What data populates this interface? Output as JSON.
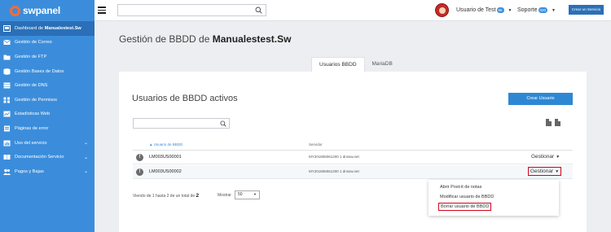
{
  "app": {
    "logo_text": "swpanel"
  },
  "sidebar": {
    "items": [
      {
        "label_prefix": "Dashboard de ",
        "label_bold": "Manualestest.Sw",
        "icon": "dashboard-icon"
      },
      {
        "label": "Gestión de Correo",
        "icon": "envelope-icon"
      },
      {
        "label": "Gestión de FTP",
        "icon": "ftp-folder-icon"
      },
      {
        "label": "Gestión Bases de Datos",
        "icon": "database-icon"
      },
      {
        "label": "Gestión de DNS",
        "icon": "dns-stack-icon"
      },
      {
        "label": "Gestión de Permisos",
        "icon": "permissions-grid-icon"
      },
      {
        "label": "Estadísticas Web",
        "icon": "stats-icon"
      },
      {
        "label": "Páginas de error",
        "icon": "error-page-icon"
      },
      {
        "label": "Uso del servicio",
        "icon": "usage-icon",
        "chevron": "⌄"
      },
      {
        "label": "Documentación Servicio",
        "icon": "docs-icon",
        "chevron": "⌄"
      },
      {
        "label": "Pagos y Bajas",
        "icon": "payments-icon",
        "chevron": "⌄"
      }
    ]
  },
  "topbar": {
    "search_placeholder": "",
    "user_label": "Usuario de Test",
    "user_badge": "86",
    "soporte_label": "Soporte",
    "soporte_badge": "020",
    "create_service": "Crear un Servicio"
  },
  "page": {
    "title_prefix": "Gestión de BBDD de ",
    "title_bold": "Manualestest.Sw",
    "tabs": [
      {
        "label": "Usuarios BBDD",
        "active": true
      },
      {
        "label": "MariaDB",
        "active": false
      }
    ]
  },
  "panel": {
    "title": "Usuarios de BBDD activos",
    "create_button": "Crear Usuario",
    "filter_placeholder": "",
    "columns": [
      "▲ Usuario de BBDD",
      "Servidor"
    ],
    "rows": [
      {
        "user": "LM003US00001",
        "server": "MY201806061200 1 dnssw.net",
        "action": "Gestionar"
      },
      {
        "user": "LM003US00002",
        "server": "MY201806061200 1 dnssw.net",
        "action": "Gestionar"
      }
    ],
    "pager": {
      "prefix": "Viendo de",
      "from": "1",
      "mid": "hasta",
      "to": "2",
      "mid2": "de un total de",
      "total": "2"
    },
    "show_label": "Mostrar",
    "page_size": "50"
  },
  "dropdown": {
    "items": [
      "Abrir Post-it de notas",
      "Modificar usuario de BBDD",
      "Borrar usuario de BBDD"
    ]
  },
  "colors": {
    "sidebar": "#3b8ddb",
    "accent": "#2e87d3",
    "highlight_box": "#d0021b"
  }
}
